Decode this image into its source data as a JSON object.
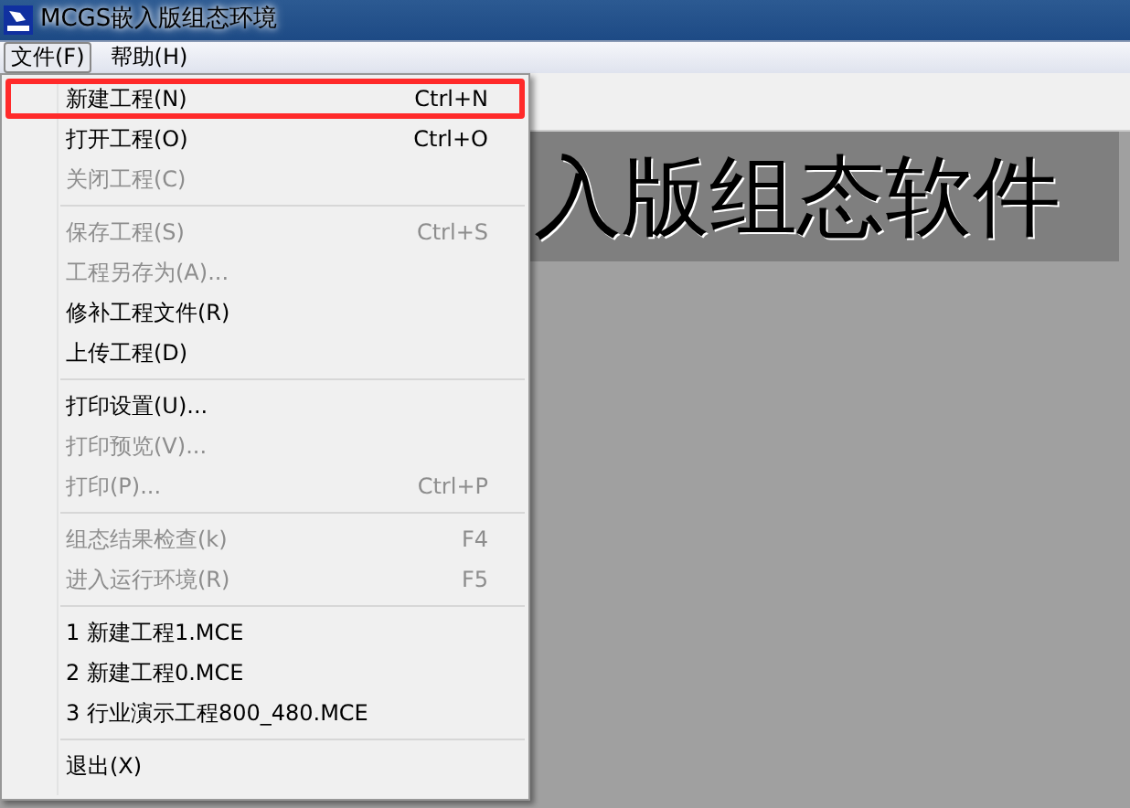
{
  "window": {
    "title": "MCGS嵌入版组态环境"
  },
  "menu_bar": [
    {
      "label": "文件(F)",
      "selected": true
    },
    {
      "label": "帮助(H)",
      "selected": false
    }
  ],
  "banner": {
    "text": "入版组态软件"
  },
  "file_menu": [
    {
      "kind": "item",
      "label": "新建工程(N)",
      "shortcut": "Ctrl+N",
      "disabled": false,
      "highlighted": true
    },
    {
      "kind": "item",
      "label": "打开工程(O)",
      "shortcut": "Ctrl+O",
      "disabled": false,
      "highlighted": false
    },
    {
      "kind": "item",
      "label": "关闭工程(C)",
      "disabled": true,
      "highlighted": false
    },
    {
      "kind": "separator"
    },
    {
      "kind": "item",
      "label": "保存工程(S)",
      "shortcut": "Ctrl+S",
      "disabled": true,
      "highlighted": false
    },
    {
      "kind": "item",
      "label": "工程另存为(A)...",
      "disabled": true,
      "highlighted": false
    },
    {
      "kind": "item",
      "label": "修补工程文件(R)",
      "disabled": false,
      "highlighted": false
    },
    {
      "kind": "item",
      "label": "上传工程(D)",
      "disabled": false,
      "highlighted": false
    },
    {
      "kind": "separator"
    },
    {
      "kind": "item",
      "label": "打印设置(U)...",
      "disabled": false,
      "highlighted": false
    },
    {
      "kind": "item",
      "label": "打印预览(V)...",
      "disabled": true,
      "highlighted": false
    },
    {
      "kind": "item",
      "label": "打印(P)...",
      "shortcut": "Ctrl+P",
      "disabled": true,
      "highlighted": false
    },
    {
      "kind": "separator"
    },
    {
      "kind": "item",
      "label": "组态结果检查(k)",
      "shortcut": "F4",
      "disabled": true,
      "highlighted": false
    },
    {
      "kind": "item",
      "label": "进入运行环境(R)",
      "shortcut": "F5",
      "disabled": true,
      "highlighted": false
    },
    {
      "kind": "separator"
    },
    {
      "kind": "item",
      "label": "1 新建工程1.MCE",
      "disabled": false,
      "highlighted": false
    },
    {
      "kind": "item",
      "label": "2 新建工程0.MCE",
      "disabled": false,
      "highlighted": false
    },
    {
      "kind": "item",
      "label": "3 行业演示工程800_480.MCE",
      "disabled": false,
      "highlighted": false
    },
    {
      "kind": "separator"
    },
    {
      "kind": "item",
      "label": "退出(X)",
      "disabled": false,
      "highlighted": false
    }
  ]
}
